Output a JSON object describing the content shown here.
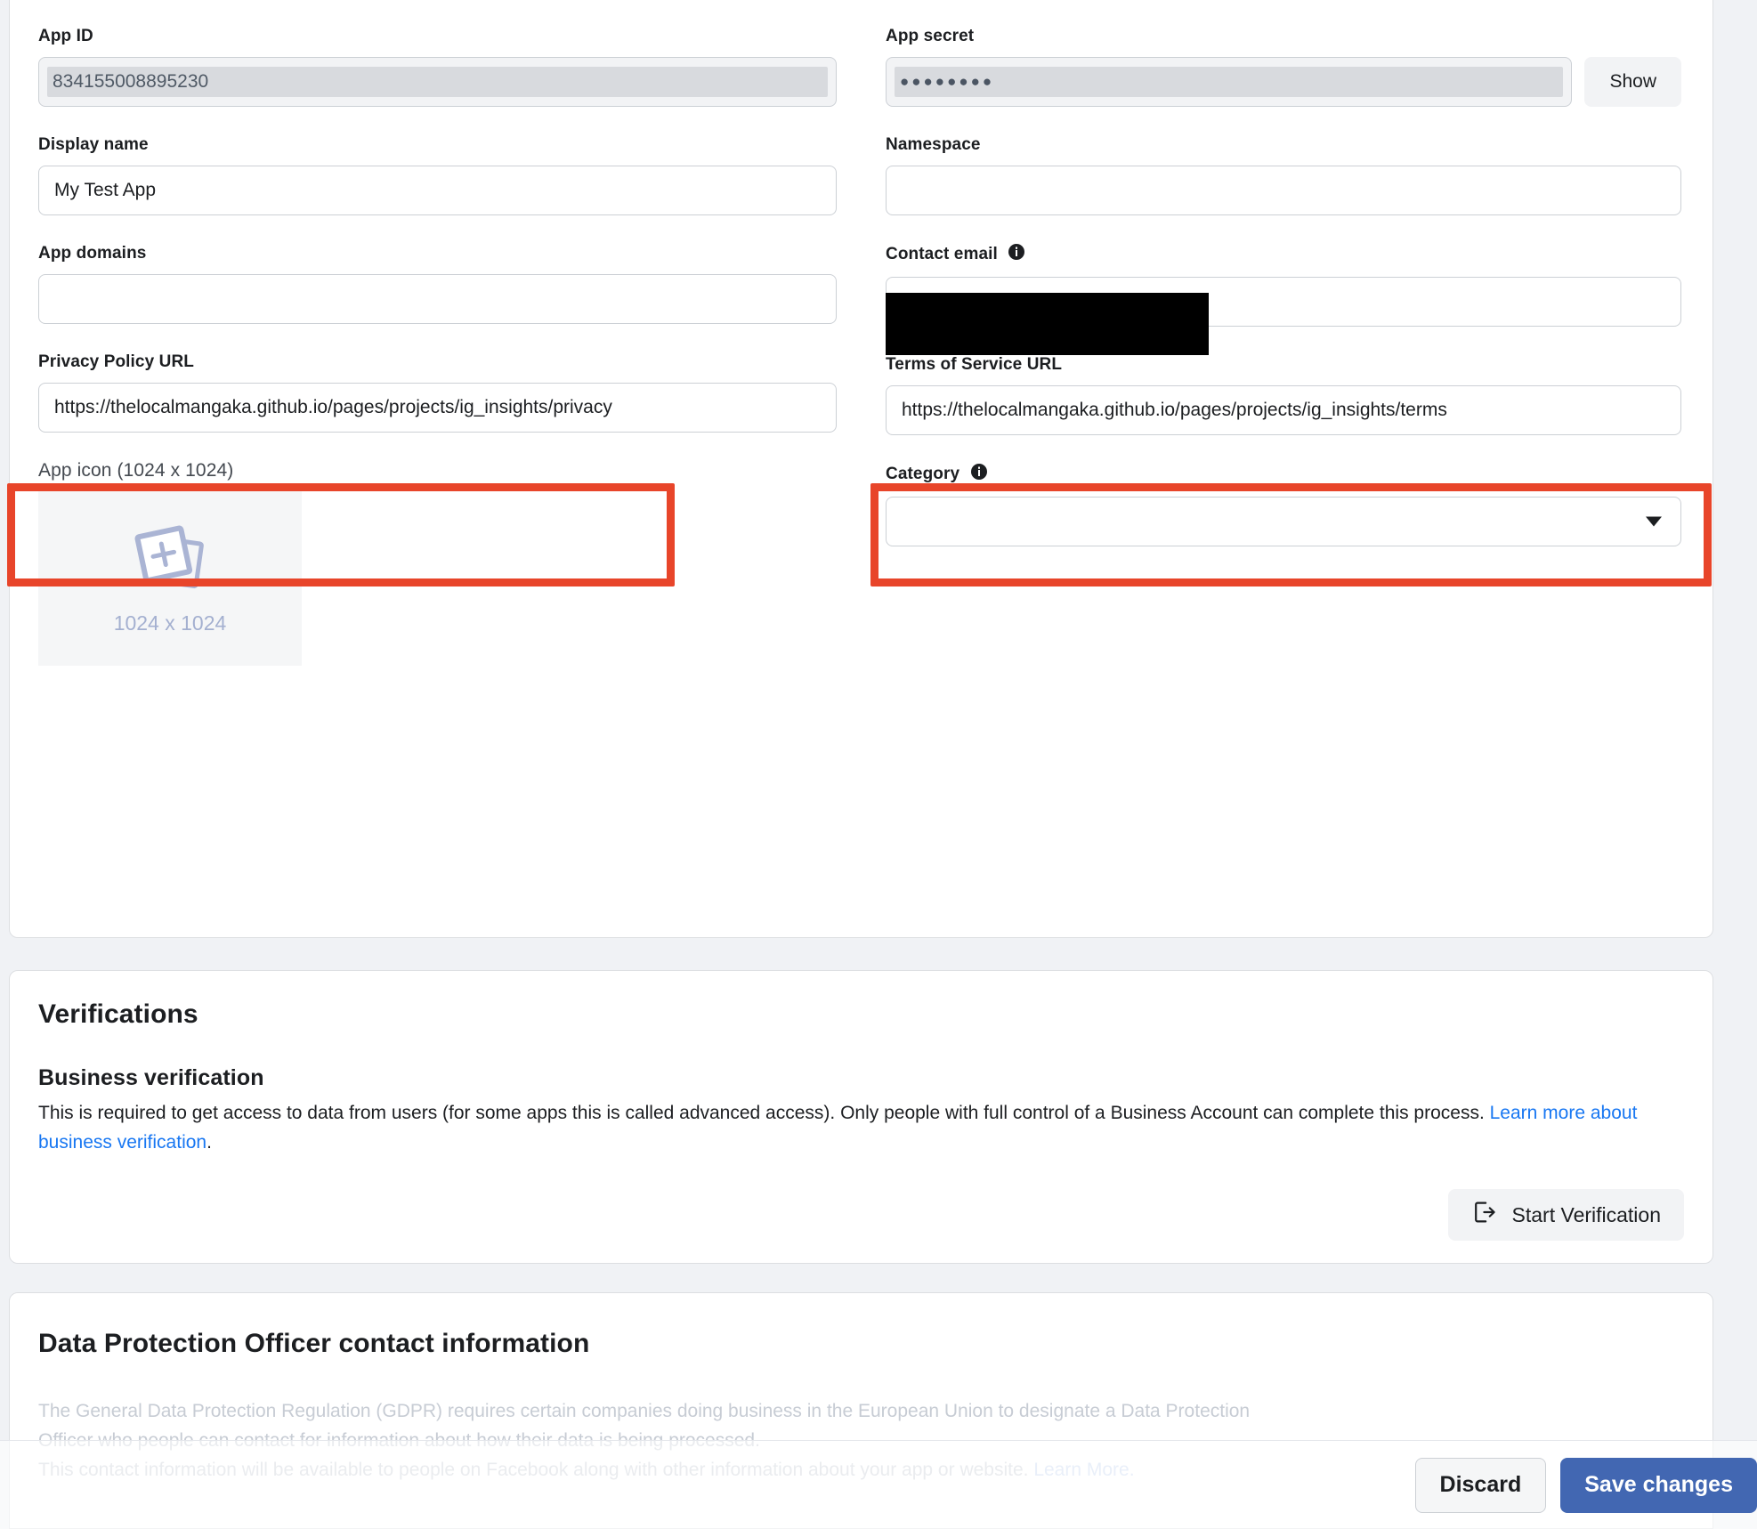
{
  "basic": {
    "app_id": {
      "label": "App ID",
      "value": "834155008895230"
    },
    "app_secret": {
      "label": "App secret",
      "value": "●●●●●●●●",
      "show_button": "Show"
    },
    "display_name": {
      "label": "Display name",
      "value": "My Test App",
      "placeholder": ""
    },
    "namespace": {
      "label": "Namespace",
      "value": "",
      "placeholder": ""
    },
    "app_domains": {
      "label": "App domains",
      "value": "",
      "placeholder": ""
    },
    "contact_email": {
      "label": "Contact email",
      "value": "",
      "placeholder": "",
      "redacted": true
    },
    "privacy_policy_url": {
      "label": "Privacy Policy URL",
      "value": "https://thelocalmangaka.github.io/pages/projects/ig_insights/privacy",
      "visible_text": "https://thelocalmangaka.github.io/pages/projects/ig_insights/privac",
      "highlighted": true
    },
    "terms_of_service_url": {
      "label": "Terms of Service URL",
      "value": "https://thelocalmangaka.github.io/pages/projects/ig_insights/terms",
      "visible_text": "https://thelocalmangaka.github.io/pages/projects/ig_insights/terms",
      "highlighted": true
    },
    "app_icon": {
      "label": "App icon (1024 x 1024)",
      "placeholder_text": "1024 x 1024"
    },
    "category": {
      "label": "Category",
      "value": "",
      "placeholder": ""
    }
  },
  "verifications": {
    "title": "Verifications",
    "business": {
      "heading": "Business verification",
      "body_part1": "This is required to get access to data from users (for some apps this is called advanced access). Only people with full control of a Business Account can complete this process. ",
      "link_text": "Learn more about business verification",
      "body_part2": ".",
      "start_button": "Start Verification"
    }
  },
  "dpo": {
    "title": "Data Protection Officer contact information",
    "body_line1": "The General Data Protection Regulation (GDPR) requires certain companies doing business in the European Union to designate a Data Protection",
    "body_line2": "Officer who people can contact for information about how their data is being processed.",
    "body_line3": "This contact information will be available to people on Facebook along with other information about your app or website. ",
    "link_text": "Learn More."
  },
  "savebar": {
    "discard": "Discard",
    "save": "Save changes"
  },
  "colors": {
    "annotation_red": "#e8452a",
    "primary_blue": "#4267b2",
    "link_blue": "#1877f2",
    "page_bg": "#f0f2f5",
    "redaction_black": "#000000"
  }
}
